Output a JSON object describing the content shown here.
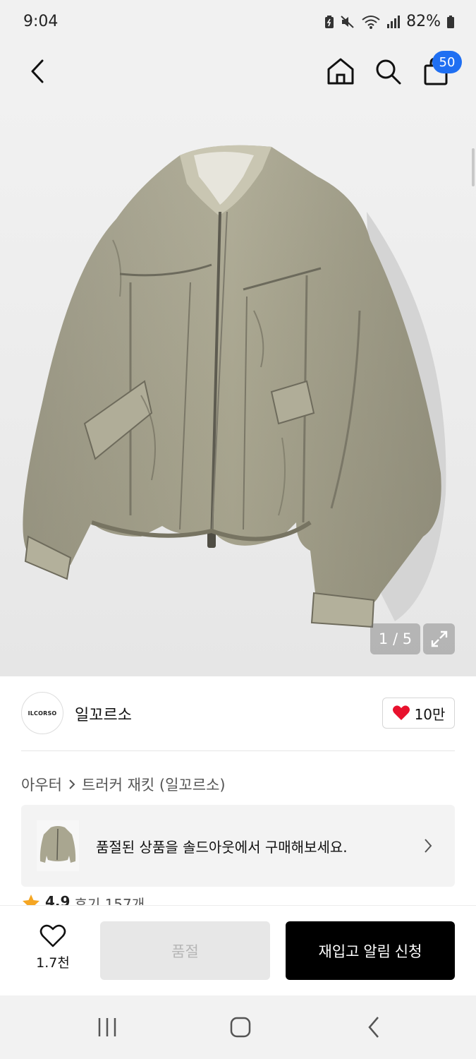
{
  "status_bar": {
    "time": "9:04",
    "battery": "82%"
  },
  "nav": {
    "cart_count": "50"
  },
  "gallery": {
    "counter": "1 / 5"
  },
  "brand": {
    "logo_text": "ILCORSO",
    "name": "일꼬르소",
    "likes": "10만"
  },
  "breadcrumb": {
    "category": "아우터",
    "product": "트러커 재킷 (일꼬르소)"
  },
  "soldout_banner": {
    "text": "품절된 상품을 솔드아웃에서 구매해보세요."
  },
  "rating": {
    "score": "4.9",
    "reviews": "후기 157개"
  },
  "actions": {
    "wish_count": "1.7천",
    "soldout_label": "품절",
    "restock_label": "재입고 알림 신청"
  },
  "colors": {
    "accent_blue": "#1f6ff2",
    "heart_red": "#e8112d",
    "star_orange": "#f5a623"
  }
}
